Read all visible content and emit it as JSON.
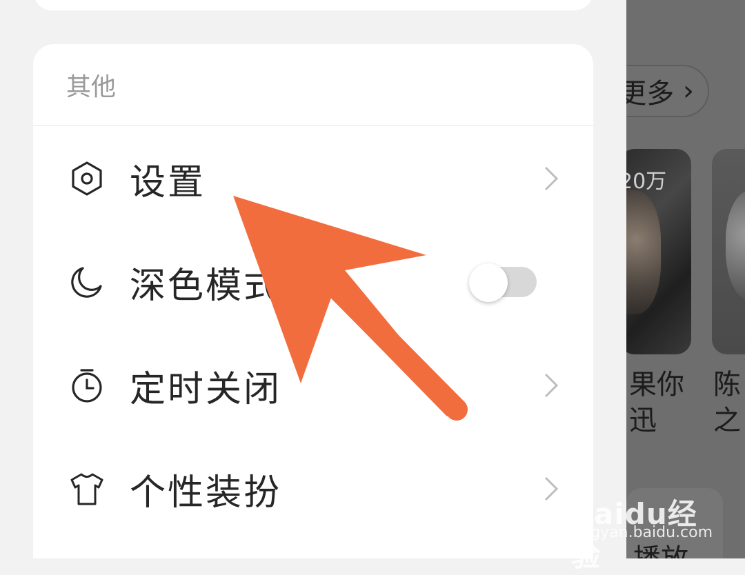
{
  "drawer": {
    "section_title": "其他",
    "items": [
      {
        "label": "设置",
        "icon": "hexagon-settings-icon",
        "trailing": "chevron"
      },
      {
        "label": "深色模式",
        "icon": "moon-icon",
        "trailing": "toggle",
        "toggle_on": false
      },
      {
        "label": "定时关闭",
        "icon": "timer-icon",
        "trailing": "chevron"
      },
      {
        "label": "个性装扮",
        "icon": "tshirt-icon",
        "trailing": "chevron"
      }
    ]
  },
  "background": {
    "more_label": "更多",
    "play_count": "20万",
    "captions": [
      "果你\n迅",
      "陈￼\n之"
    ],
    "bottom_text": "播放"
  },
  "watermark": {
    "brand": "Baidu经验",
    "url": "jingyan.baidu.com"
  },
  "colors": {
    "arrow": "#f26d3d",
    "overlay": "#6e6e6e",
    "card": "#ffffff"
  }
}
